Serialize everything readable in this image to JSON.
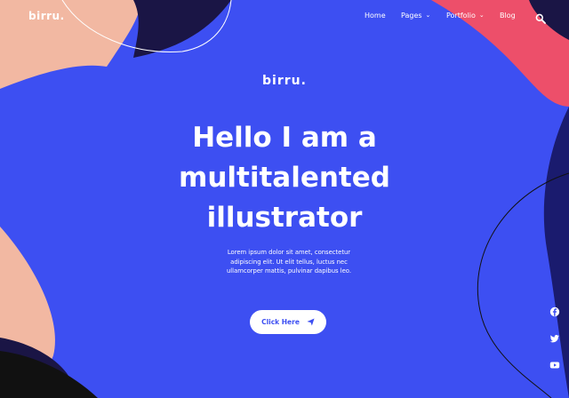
{
  "brand": {
    "logo_text": "birru."
  },
  "nav": {
    "items": [
      {
        "label": "Home"
      },
      {
        "label": "Pages"
      },
      {
        "label": "Portfolio"
      },
      {
        "label": "Blog"
      }
    ]
  },
  "hero": {
    "logo_text": "birru.",
    "headline": "Hello I am a multitalented illustrator",
    "body": "Lorem ipsum dolor sit amet, consectetur adipiscing elit. Ut elit tellus, luctus nec ullamcorper mattis, pulvinar dapibus leo.",
    "cta_label": "Click Here"
  },
  "icons": {
    "search": "search-icon",
    "chevron": "chevron-down-icon",
    "cta": "paper-plane-icon",
    "social": [
      "facebook-icon",
      "twitter-icon",
      "youtube-icon"
    ]
  },
  "colors": {
    "background": "#3d4ff2",
    "peach": "#f2b8a2",
    "coral": "#ed4f6a",
    "navy": "#1a1545",
    "black": "#111111",
    "text": "#ffffff"
  }
}
